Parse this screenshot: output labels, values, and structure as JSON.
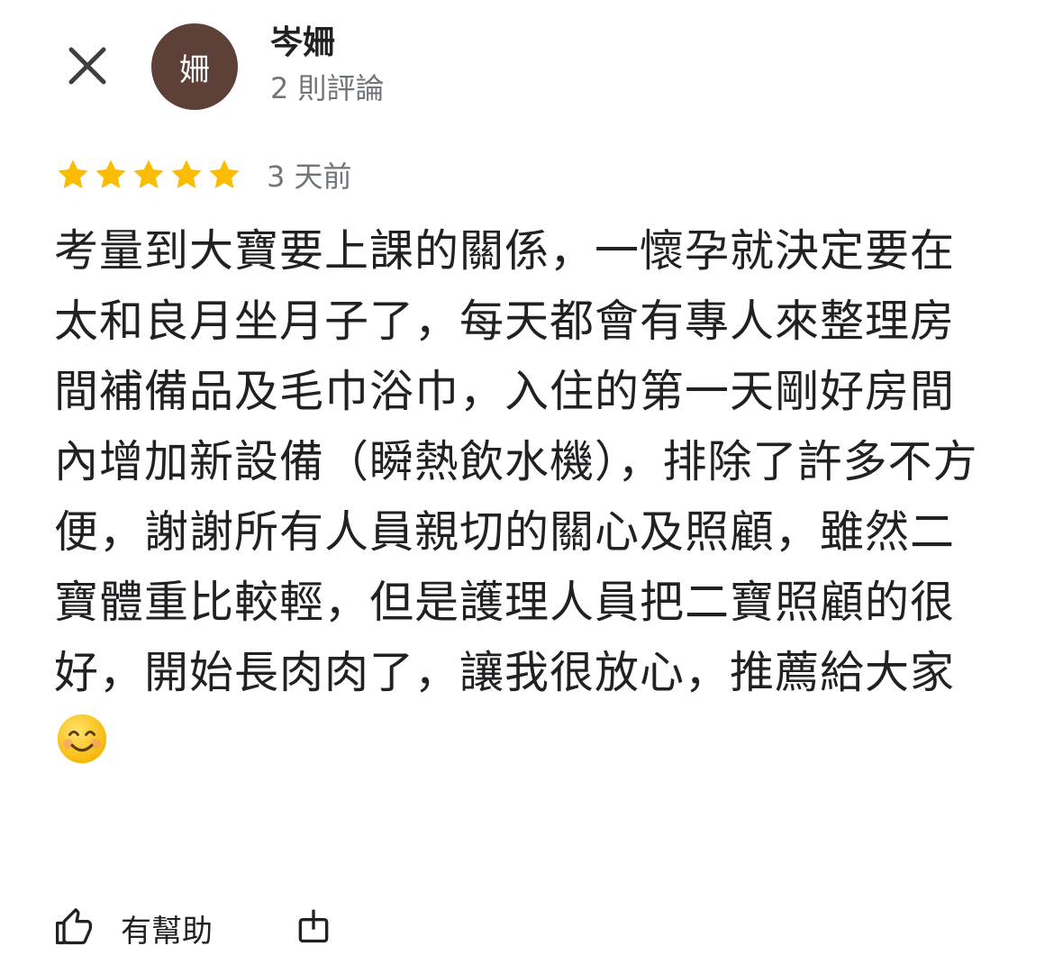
{
  "header": {
    "close_icon": "close-icon",
    "avatar_letter": "姍",
    "avatar_color": "#5d4037",
    "reviewer_name": "岑姍",
    "review_count": "2 則評論"
  },
  "review": {
    "rating": 5,
    "rating_max": 5,
    "star_color": "#fbbc04",
    "time": "3 天前",
    "text": "考量到大寶要上課的關係，一懷孕就決定要在太和良月坐月子了，每天都會有專人來整理房間補備品及毛巾浴巾，入住的第一天剛好房間內增加新設備（瞬熱飲水機），排除了許多不方便，謝謝所有人員親切的關心及照顧，雖然二寶體重比較輕，但是護理人員把二寶照顧的很好，開始長肉肉了，讓我很放心，推薦給大家",
    "emoji_icon": "smiling-face-emoji"
  },
  "footer": {
    "helpful_label": "有幫助",
    "helpful_icon": "thumbs-up-icon",
    "share_icon": "share-icon"
  }
}
